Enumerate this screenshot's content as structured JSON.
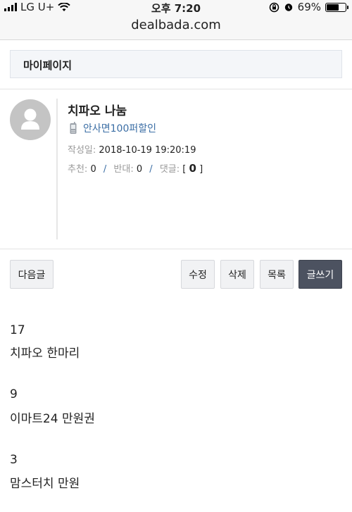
{
  "status_bar": {
    "carrier": "LG U+",
    "time": "오후 7:20",
    "battery": "69%",
    "battery_level": 0.69
  },
  "address_bar": {
    "url": "dealbada.com"
  },
  "page": {
    "title": "마이페이지"
  },
  "post": {
    "title": "치파오 나눔",
    "author": "안사면100퍼할인",
    "date_label": "작성일:",
    "date_value": "2018-10-19 19:20:19",
    "recommend_label": "추천:",
    "recommend_value": "0",
    "oppose_label": "반대:",
    "oppose_value": "0",
    "comments_label": "댓글:",
    "comments_open": "[",
    "comments_value": "0",
    "comments_close": "]",
    "separator": "/"
  },
  "buttons": {
    "next": "다음글",
    "edit": "수정",
    "delete": "삭제",
    "list": "목록",
    "write": "글쓰기"
  },
  "content": {
    "lines": [
      "17",
      "치파오 한마리",
      "9",
      "이마트24 만원권",
      "3",
      "맘스터치 만원"
    ]
  },
  "icons": {
    "avatar": "user-silhouette-icon",
    "author": "mobile-phone-icon",
    "wifi": "wifi-icon",
    "lock": "orientation-lock-icon",
    "alarm": "alarm-icon"
  }
}
